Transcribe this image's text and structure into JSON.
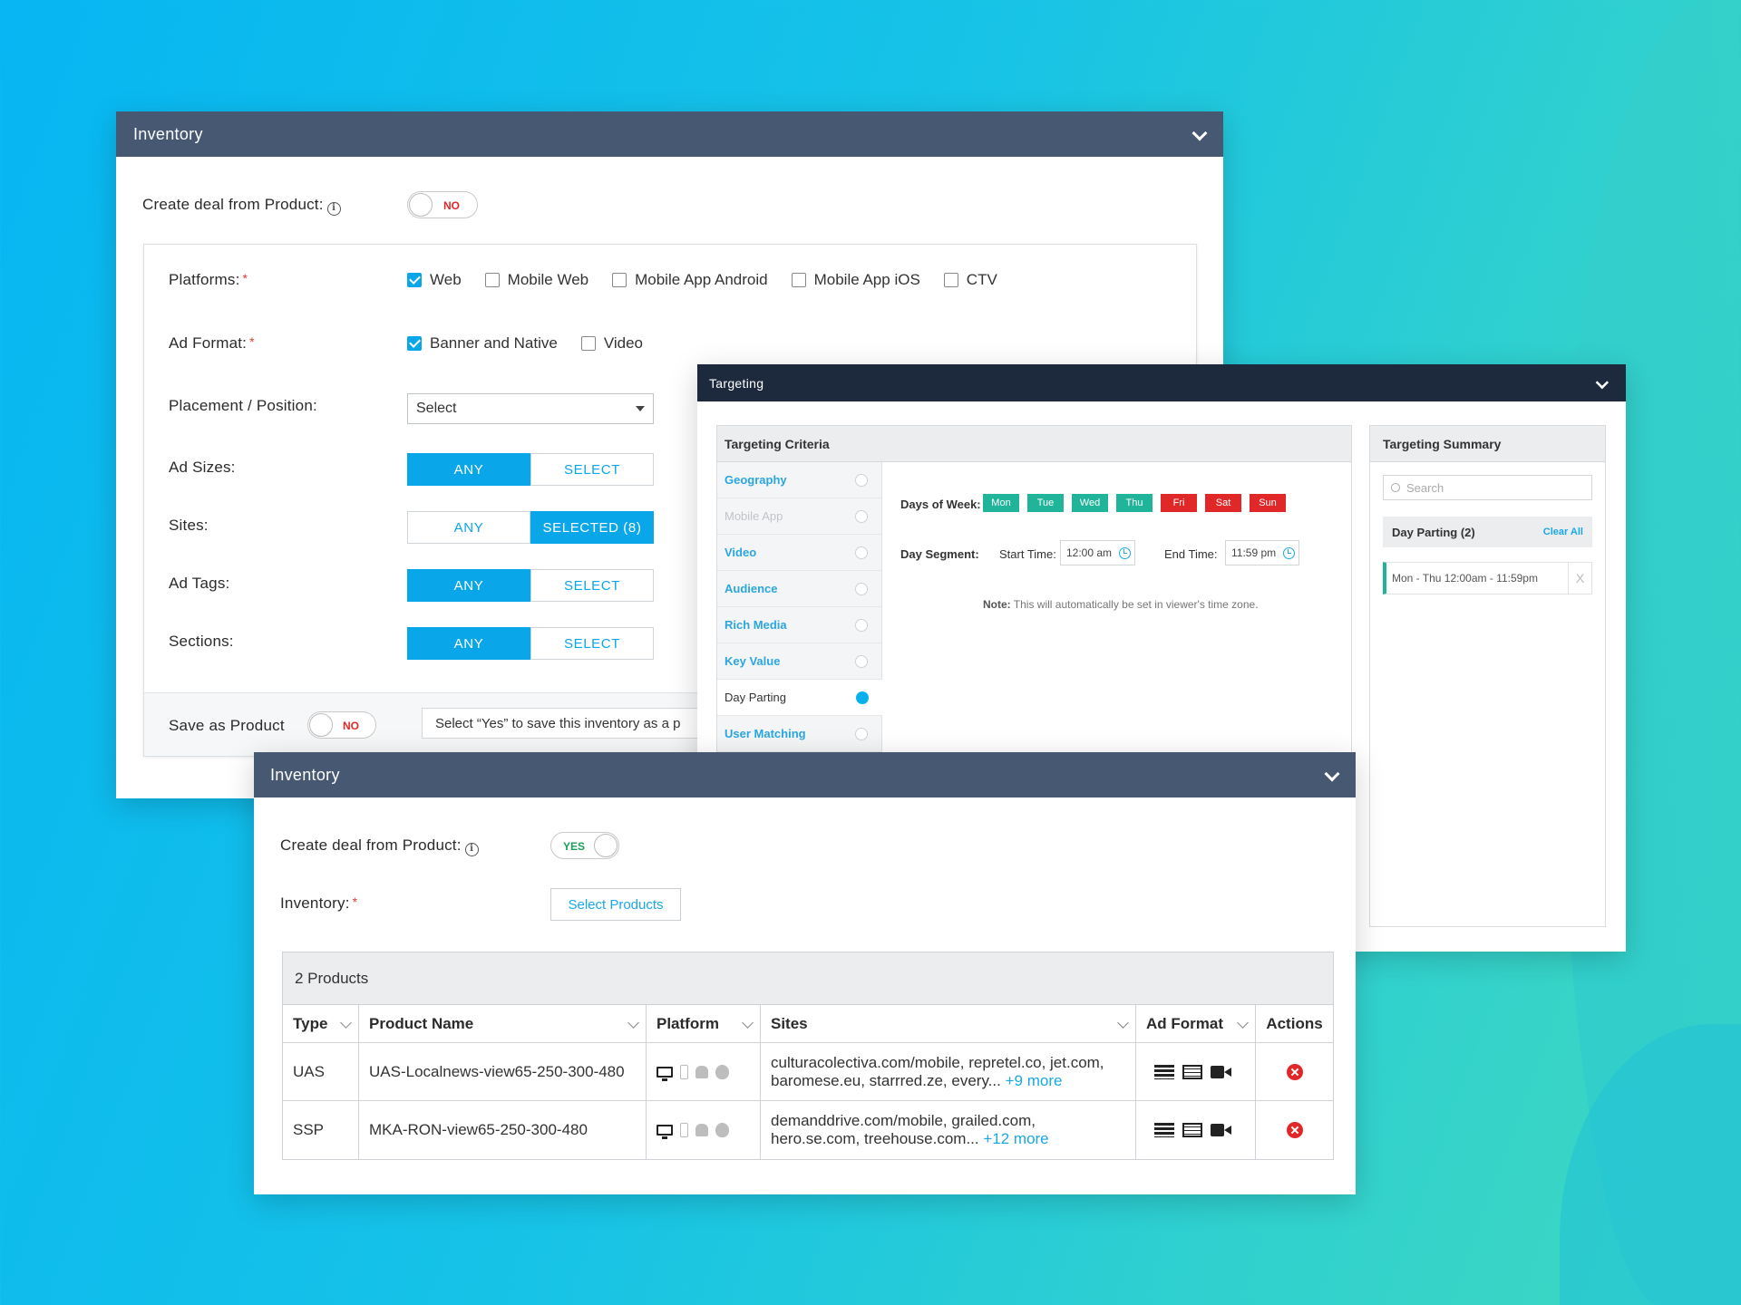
{
  "panel1": {
    "title": "Inventory",
    "create_deal_label": "Create deal from Product:",
    "create_deal_toggle": "NO",
    "platforms_label": "Platforms:",
    "platforms": [
      {
        "label": "Web",
        "checked": true
      },
      {
        "label": "Mobile Web",
        "checked": false
      },
      {
        "label": "Mobile App Android",
        "checked": false
      },
      {
        "label": "Mobile App iOS",
        "checked": false
      },
      {
        "label": "CTV",
        "checked": false
      }
    ],
    "ad_format_label": "Ad Format:",
    "ad_formats": [
      {
        "label": "Banner and Native",
        "checked": true
      },
      {
        "label": "Video",
        "checked": false
      }
    ],
    "placement_label": "Placement / Position:",
    "placement_value": "Select",
    "ad_sizes_label": "Ad Sizes:",
    "sites_label": "Sites:",
    "ad_tags_label": "Ad Tags:",
    "sections_label": "Sections:",
    "any_label": "ANY",
    "select_label": "SELECT",
    "sites_selected_label": "SELECTED (8)",
    "save_as_product_label": "Save as Product",
    "save_toggle": "NO",
    "save_hint": "Select “Yes” to save this inventory as a p"
  },
  "targeting": {
    "title": "Targeting",
    "criteria_title": "Targeting Criteria",
    "criteria": [
      {
        "label": "Geography",
        "state": "link"
      },
      {
        "label": "Mobile App",
        "state": "dim"
      },
      {
        "label": "Video",
        "state": "link"
      },
      {
        "label": "Audience",
        "state": "link"
      },
      {
        "label": "Rich Media",
        "state": "link"
      },
      {
        "label": "Key Value",
        "state": "link"
      },
      {
        "label": "Day Parting",
        "state": "active"
      },
      {
        "label": "User Matching",
        "state": "link"
      }
    ],
    "days_label": "Days of Week:",
    "days": [
      {
        "label": "Mon",
        "color": "#20b59a"
      },
      {
        "label": "Tue",
        "color": "#20b59a"
      },
      {
        "label": "Wed",
        "color": "#20b59a"
      },
      {
        "label": "Thu",
        "color": "#20b59a"
      },
      {
        "label": "Fri",
        "color": "#e02828"
      },
      {
        "label": "Sat",
        "color": "#e02828"
      },
      {
        "label": "Sun",
        "color": "#e02828"
      }
    ],
    "day_segment_label": "Day Segment:",
    "start_time_label": "Start Time:",
    "start_time": "12:00 am",
    "end_time_label": "End Time:",
    "end_time": "11:59 pm",
    "note_label": "Note:",
    "note_text": "This will automatically be set in viewer's time zone.",
    "summary_title": "Targeting Summary",
    "search_placeholder": "Search",
    "day_parting_label": "Day Parting (2)",
    "clear_all": "Clear All",
    "summary_item": "Mon - Thu 12:00am - 11:59pm",
    "remove_x": "X"
  },
  "panel2": {
    "title": "Inventory",
    "create_deal_label": "Create deal from Product:",
    "create_deal_toggle": "YES",
    "inventory_label": "Inventory:",
    "select_products": "Select Products",
    "table_caption": "2 Products",
    "columns": [
      "Type",
      "Product Name",
      "Platform",
      "Sites",
      "Ad Format",
      "Actions"
    ],
    "rows": [
      {
        "type": "UAS",
        "name": "UAS-Localnews-view65-250-300-480",
        "sites_line1": "culturacolectiva.com/mobile, repretel.co, jet.com,",
        "sites_line2": "baromese.eu, starrred.ze, every...",
        "more": "+9 more"
      },
      {
        "type": "SSP",
        "name": "MKA-RON-view65-250-300-480",
        "sites_line1": "demanddrive.com/mobile, grailed.com,",
        "sites_line2": "hero.se.com, treehouse.com...",
        "more": "+12 more"
      }
    ]
  },
  "colors": {
    "accent": "#0aa6ea",
    "header": "#475872",
    "targeting_header": "#1d2a3d",
    "toggle_no": "#e02828",
    "toggle_yes": "#1a9e5a"
  }
}
